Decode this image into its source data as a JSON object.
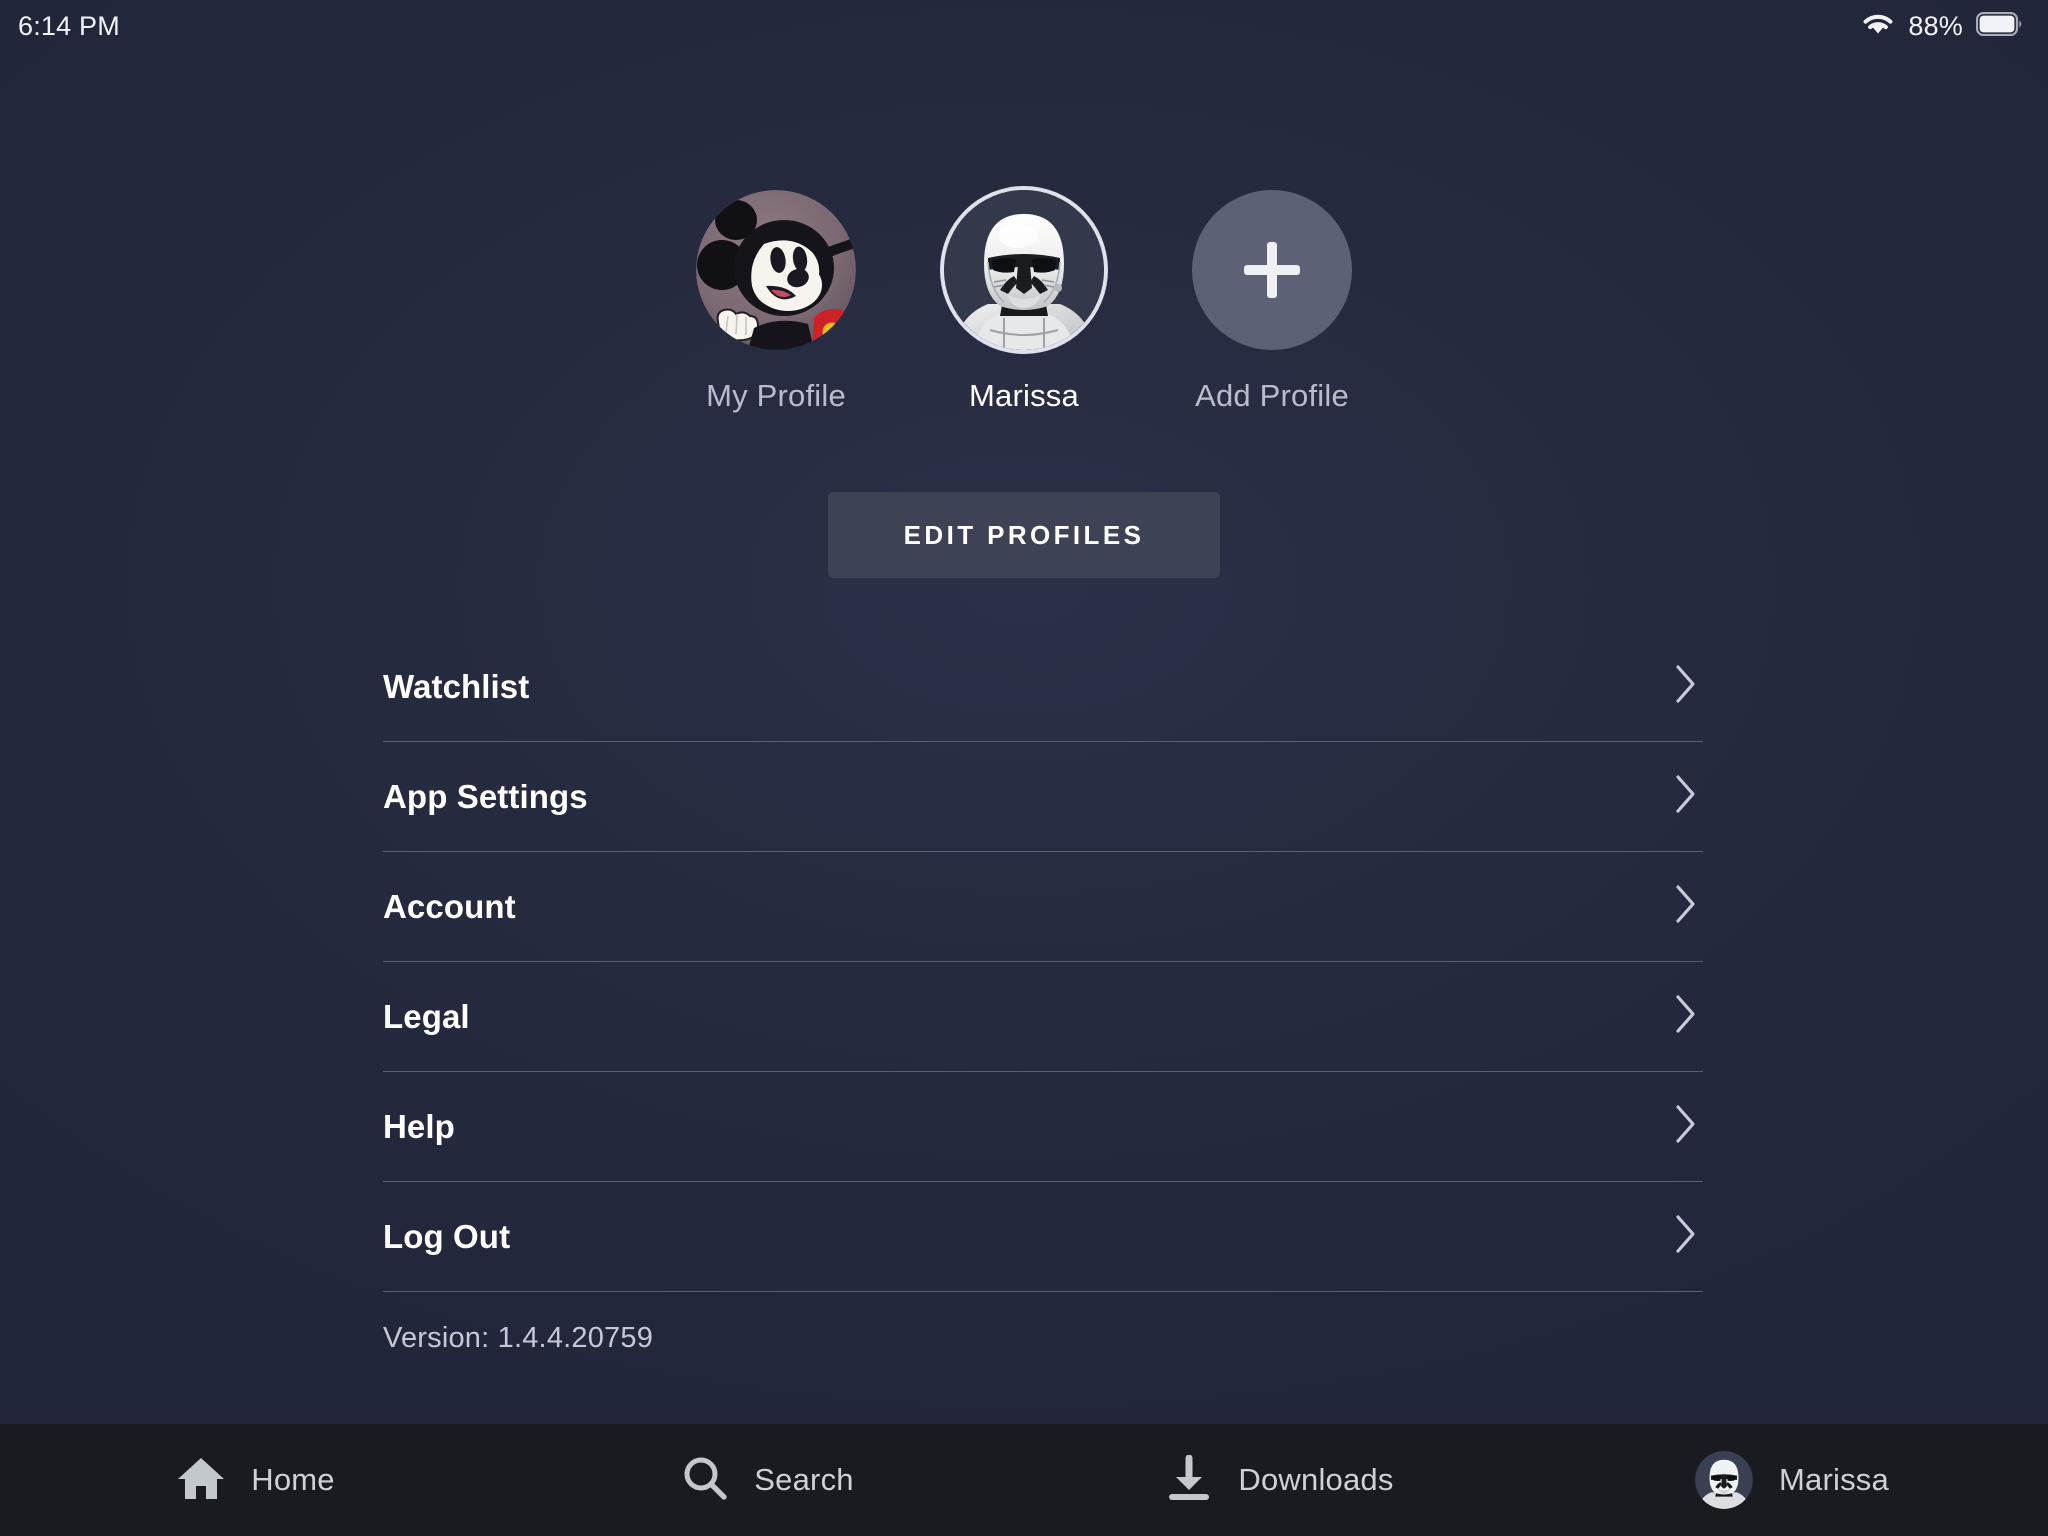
{
  "status_bar": {
    "time": "6:14 PM",
    "battery_percent": "88%",
    "wifi_icon": "wifi-icon",
    "battery_icon": "battery-icon"
  },
  "profiles": {
    "items": [
      {
        "label": "My Profile",
        "avatar": "mickey-mouse-avatar",
        "selected": false
      },
      {
        "label": "Marissa",
        "avatar": "stormtrooper-avatar",
        "selected": true
      },
      {
        "label": "Add Profile",
        "avatar": "plus-icon",
        "selected": false
      }
    ]
  },
  "edit_profiles": {
    "label": "EDIT PROFILES"
  },
  "menu": {
    "items": [
      {
        "label": "Watchlist",
        "chevron": "chevron-right-icon"
      },
      {
        "label": "App Settings",
        "chevron": "chevron-right-icon"
      },
      {
        "label": "Account",
        "chevron": "chevron-right-icon"
      },
      {
        "label": "Legal",
        "chevron": "chevron-right-icon"
      },
      {
        "label": "Help",
        "chevron": "chevron-right-icon"
      },
      {
        "label": "Log Out",
        "chevron": "chevron-right-icon"
      }
    ]
  },
  "version": {
    "text": "Version: 1.4.4.20759"
  },
  "tab_bar": {
    "items": [
      {
        "label": "Home",
        "icon": "home-icon"
      },
      {
        "label": "Search",
        "icon": "search-icon"
      },
      {
        "label": "Downloads",
        "icon": "download-icon"
      },
      {
        "label": "Marissa",
        "icon": "stormtrooper-avatar"
      }
    ]
  },
  "colors": {
    "background": "#22263a",
    "tab_bar_background": "#191b20",
    "button_background": "#3d4254",
    "add_profile_circle": "#5c6175",
    "divider": "#5a5f72",
    "text_primary": "#ffffff",
    "text_secondary": "#c5c9d4",
    "mickey_background": "#7d6b76",
    "accent_red": "#d62828",
    "accent_yellow": "#f2c010"
  }
}
